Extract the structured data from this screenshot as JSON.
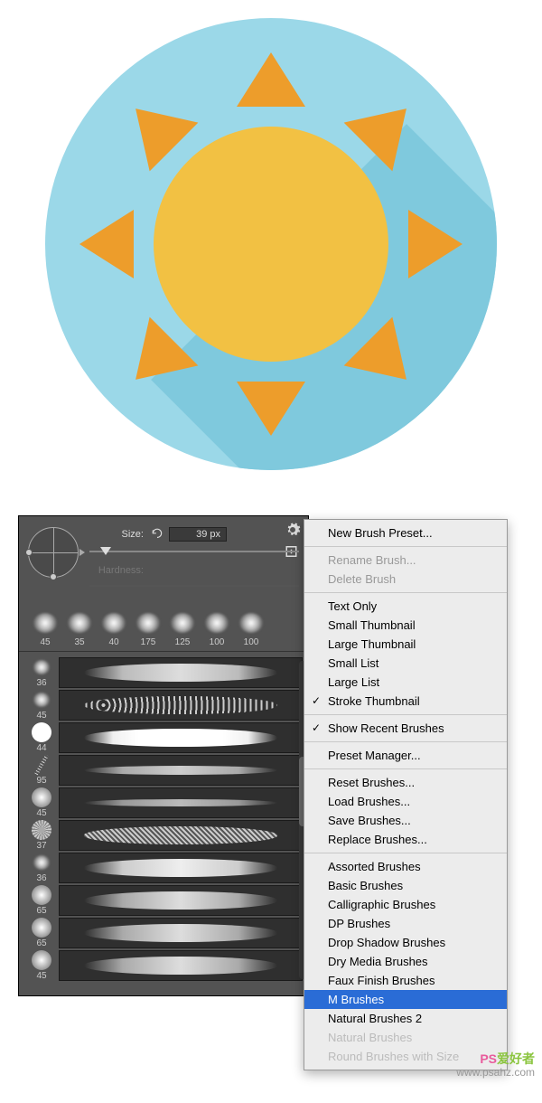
{
  "brush_panel": {
    "size_label": "Size:",
    "size_value": "39 px",
    "hardness_label": "Hardness:",
    "top_tips": [
      {
        "size": "45"
      },
      {
        "size": "35"
      },
      {
        "size": "40"
      },
      {
        "size": "175"
      },
      {
        "size": "125"
      },
      {
        "size": "100"
      },
      {
        "size": "100"
      }
    ],
    "strokes": [
      {
        "size": "36"
      },
      {
        "size": "45"
      },
      {
        "size": "44"
      },
      {
        "size": "95"
      },
      {
        "size": "45"
      },
      {
        "size": "37"
      },
      {
        "size": "36"
      },
      {
        "size": "65"
      },
      {
        "size": "65"
      },
      {
        "size": "45"
      }
    ]
  },
  "menu": {
    "new_preset": "New Brush Preset...",
    "rename": "Rename Brush...",
    "delete": "Delete Brush",
    "text_only": "Text Only",
    "small_thumb": "Small Thumbnail",
    "large_thumb": "Large Thumbnail",
    "small_list": "Small List",
    "large_list": "Large List",
    "stroke_thumb": "Stroke Thumbnail",
    "show_recent": "Show Recent Brushes",
    "preset_mgr": "Preset Manager...",
    "reset": "Reset Brushes...",
    "load": "Load Brushes...",
    "save": "Save Brushes...",
    "replace": "Replace Brushes...",
    "assorted": "Assorted Brushes",
    "basic": "Basic Brushes",
    "calligraphic": "Calligraphic Brushes",
    "dp": "DP Brushes",
    "drop_shadow": "Drop Shadow Brushes",
    "dry_media": "Dry Media Brushes",
    "faux_finish": "Faux Finish Brushes",
    "m_brushes": "M Brushes",
    "natural2": "Natural Brushes 2",
    "natural": "Natural Brushes",
    "round_size": "Round Brushes with Size"
  },
  "watermark": {
    "brand_a": "PS",
    "brand_b": "爱好者",
    "url": "www.psahz.com"
  }
}
